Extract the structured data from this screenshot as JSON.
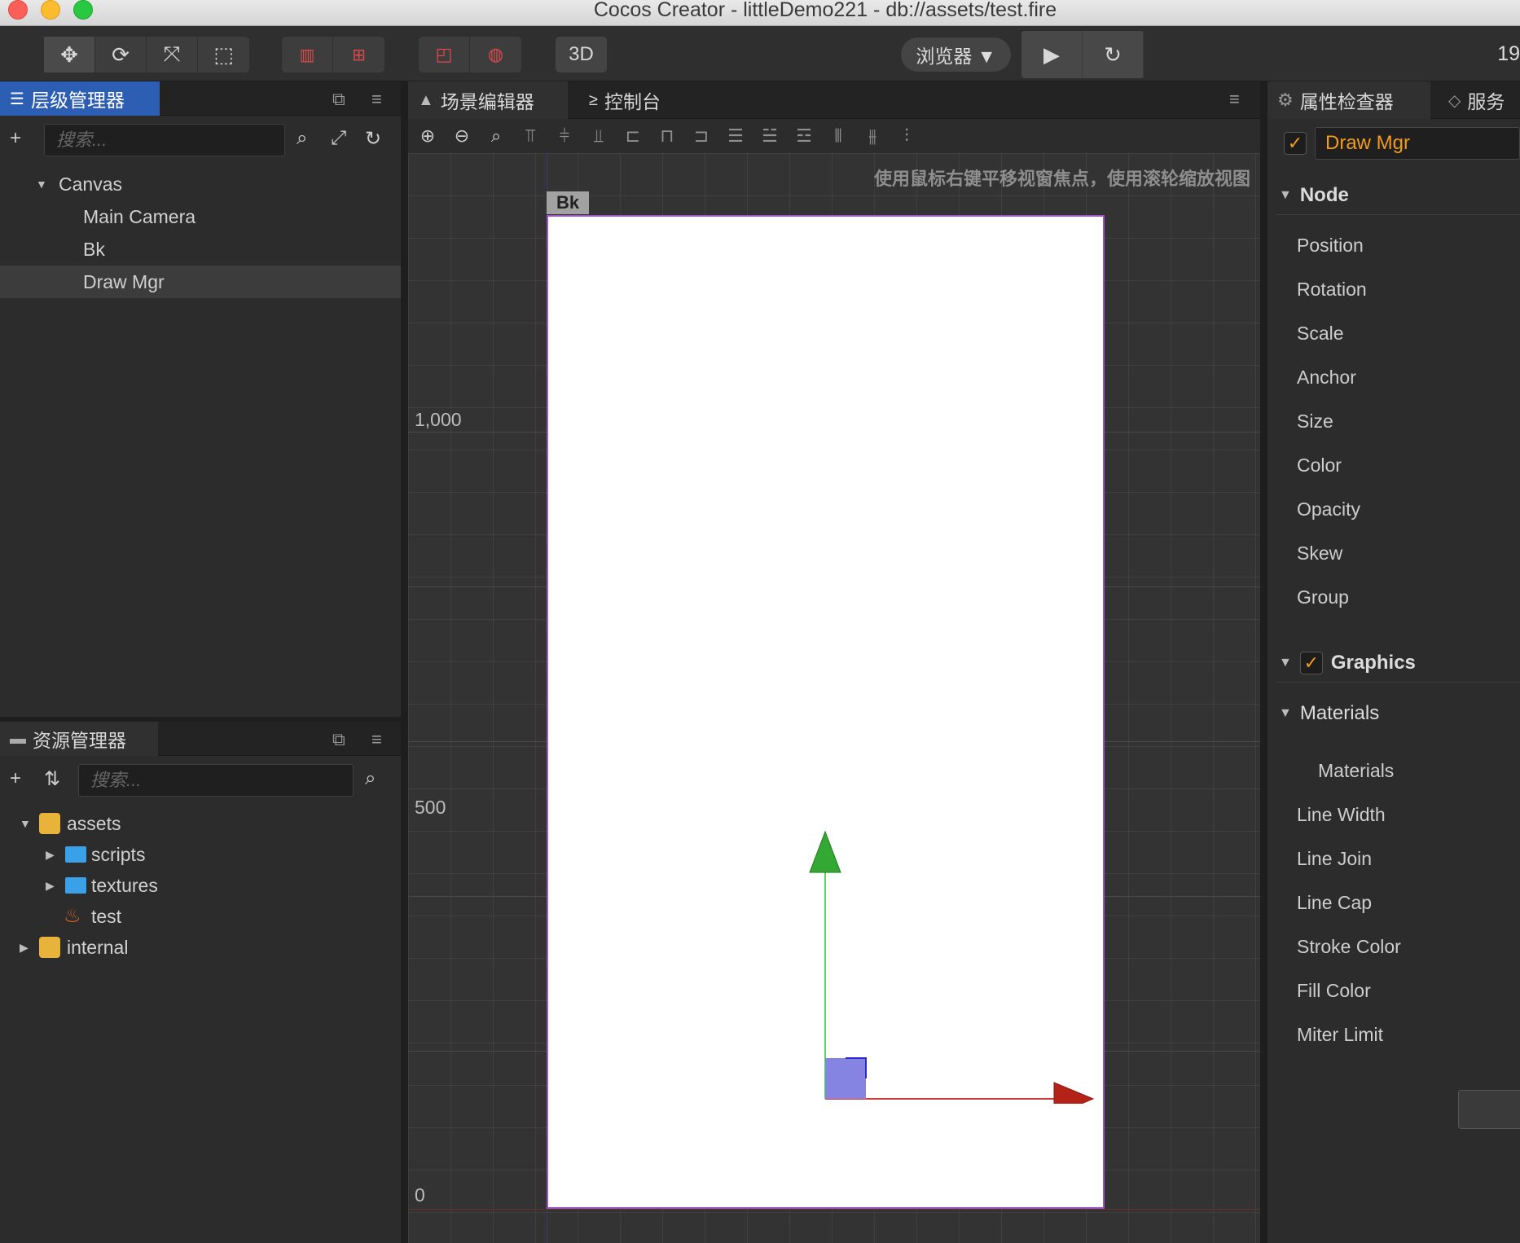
{
  "window": {
    "title": "Cocos Creator - littleDemo221 - db://assets/test.fire"
  },
  "toolbar": {
    "transform_tools": [
      "move-tool-icon",
      "rotate-tool-icon",
      "scale-tool-icon",
      "rect-tool-icon"
    ],
    "pivot_tools": [
      "pivot-icon",
      "center-icon"
    ],
    "space_tools": [
      "local-icon",
      "global-icon"
    ],
    "mode_3d": "3D",
    "preview_target": "浏览器 ▼",
    "right_number": "19"
  },
  "hierarchy": {
    "tab_label": "层级管理器",
    "search_placeholder": "搜索...",
    "items": [
      {
        "label": "Canvas"
      },
      {
        "label": "Main Camera"
      },
      {
        "label": "Bk"
      },
      {
        "label": "Draw Mgr"
      }
    ]
  },
  "assets": {
    "tab_label": "资源管理器",
    "search_placeholder": "搜索...",
    "items": [
      {
        "label": "assets"
      },
      {
        "label": "scripts"
      },
      {
        "label": "textures"
      },
      {
        "label": "test"
      },
      {
        "label": "internal"
      }
    ]
  },
  "scene": {
    "tab_scene": "场景编辑器",
    "tab_console": "控制台",
    "hint": "使用鼠标右键平移视窗焦点，使用滚轮缩放视图",
    "ruler_labels": [
      "1,000",
      "500",
      "0"
    ],
    "bk_label": "Bk"
  },
  "inspector": {
    "tab_label": "属性检查器",
    "tab_service": "服务",
    "node_name": "Draw Mgr",
    "node_section": "Node",
    "node_props": [
      "Position",
      "Rotation",
      "Scale",
      "Anchor",
      "Size",
      "Color",
      "Opacity",
      "Skew",
      "Group"
    ],
    "graphics_section": "Graphics",
    "materials_section": "Materials",
    "materials_item": "Materials",
    "graphics_props": [
      "Line Width",
      "Line Join",
      "Line Cap",
      "Stroke Color",
      "Fill Color",
      "Miter Limit"
    ]
  },
  "colors": {
    "accent_orange": "#f39c1c",
    "tab_blue": "#2c5eb3",
    "gizmo_green": "#3cb93c",
    "gizmo_red": "#c0241a"
  }
}
